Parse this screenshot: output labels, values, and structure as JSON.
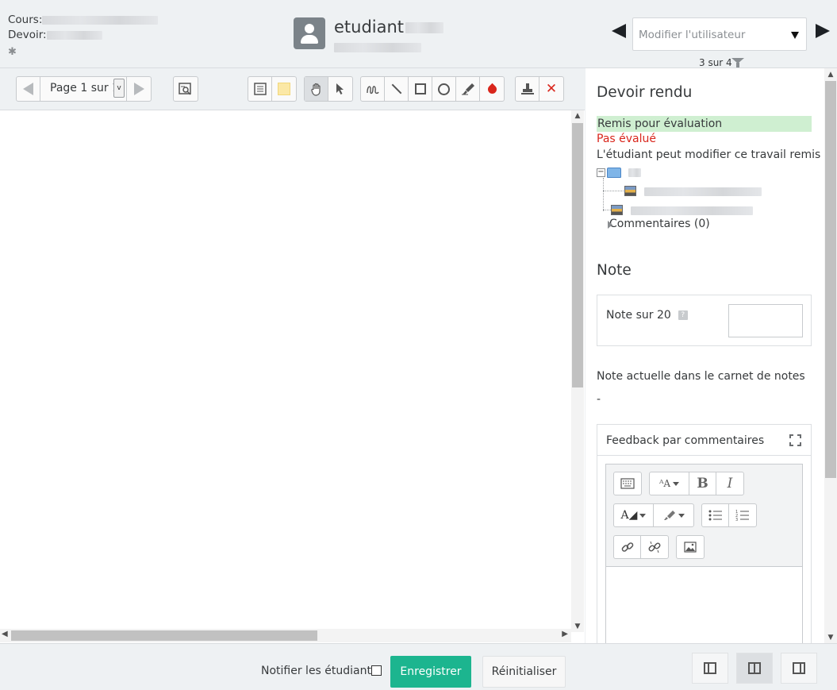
{
  "header": {
    "course_label": "Cours:",
    "assignment_label": "Devoir:",
    "user_name": "etudiant",
    "user_select_placeholder": "Modifier l'utilisateur",
    "counter": "3 sur 4"
  },
  "toolbar": {
    "page_label": "Page 1 sur 1",
    "page_dropdown_glyph": "v"
  },
  "submission": {
    "title": "Devoir rendu",
    "status_submitted": "Remis pour évaluation",
    "status_grading": "Pas évalué",
    "status_edit": "L'étudiant peut modifier ce travail remis",
    "comments": "Commentaires (0)"
  },
  "grade": {
    "title": "Note",
    "label": "Note sur 20",
    "help_glyph": "?",
    "current_label": "Note actuelle dans le carnet de notes",
    "current_value": "-"
  },
  "feedback": {
    "title": "Feedback par commentaires"
  },
  "editor": {
    "bold": "B",
    "italic": "I"
  },
  "footer": {
    "notify_label": "Notifier les étudiants",
    "save_label": "Enregistrer",
    "reset_label": "Réinitialiser"
  },
  "colors": {
    "save_button": "#1cb58f",
    "submitted_bg": "#cfefd1",
    "not_graded_text": "#d9261c"
  }
}
